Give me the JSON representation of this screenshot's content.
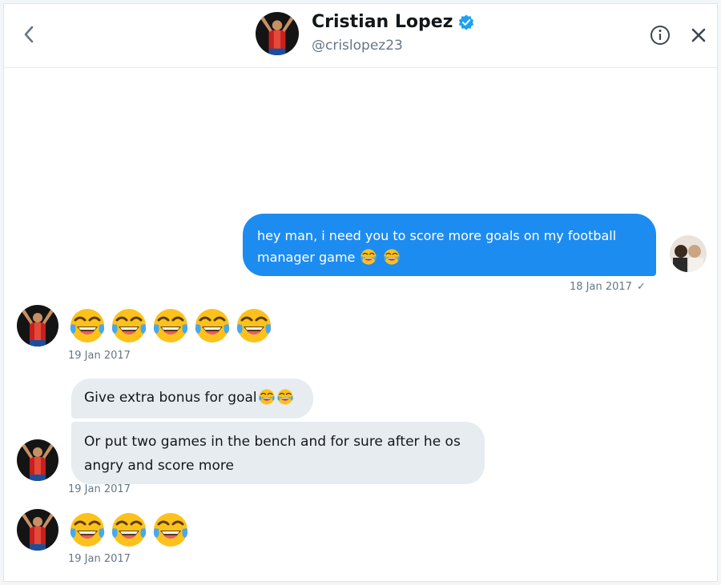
{
  "header": {
    "name": "Cristian Lopez",
    "handle": "@crislopez23",
    "verified": true,
    "icons": [
      "back-chevron-icon",
      "verified-badge-icon",
      "info-icon",
      "close-icon"
    ]
  },
  "messages": {
    "sent": {
      "text": "hey man, i need you to score more goals on my football manager game",
      "emoji_count": 2,
      "timestamp": "18 Jan 2017",
      "status_icon": "check-icon"
    },
    "received_1": {
      "emoji_count": 5,
      "timestamp": "19 Jan 2017"
    },
    "received_2": {
      "text": "Give extra bonus for goal",
      "emoji_count": 2
    },
    "received_3": {
      "text": "Or put two games in the bench and for sure after he os angry and score more",
      "timestamp": "19 Jan 2017"
    },
    "received_4": {
      "emoji_count": 3,
      "timestamp": "19 Jan 2017"
    }
  },
  "colors": {
    "sent_bubble": "#1d8cf0",
    "received_bubble": "#e6ecf0",
    "verified": "#1da1f2",
    "meta_text": "#657786"
  }
}
